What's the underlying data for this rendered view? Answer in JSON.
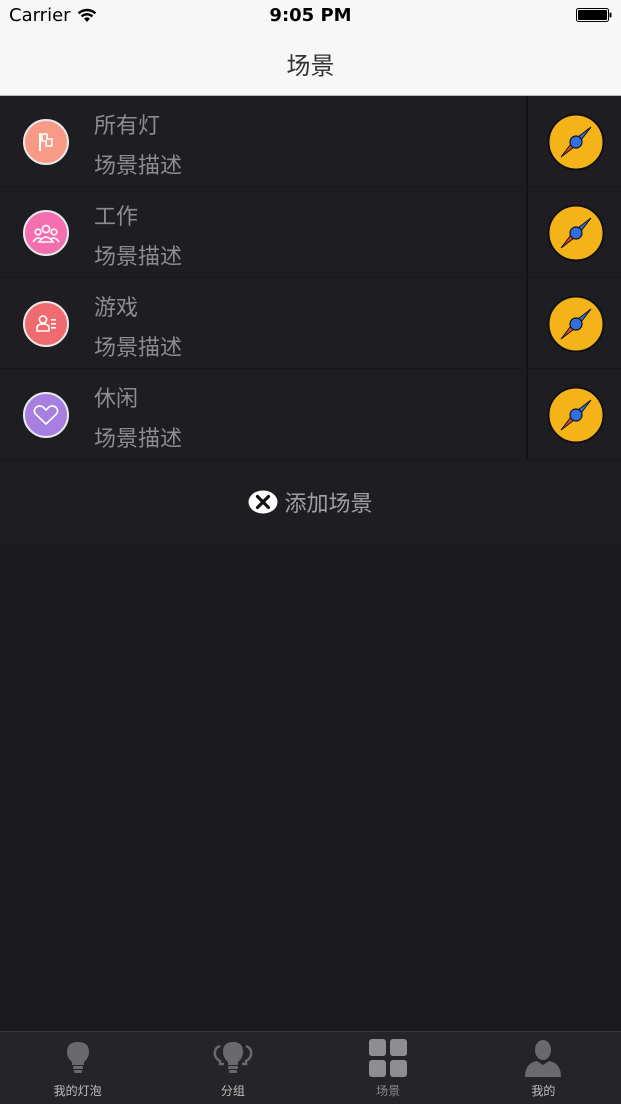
{
  "status": {
    "carrier": "Carrier",
    "time": "9:05 PM"
  },
  "nav": {
    "title": "场景"
  },
  "scenes": [
    {
      "name": "所有灯",
      "desc": "场景描述",
      "icon": "flag-icon",
      "color": "#f79b87"
    },
    {
      "name": "工作",
      "desc": "场景描述",
      "icon": "group-icon",
      "color": "#f46fb0"
    },
    {
      "name": "游戏",
      "desc": "场景描述",
      "icon": "contact-card-icon",
      "color": "#f06b6f"
    },
    {
      "name": "休闲",
      "desc": "场景描述",
      "icon": "heart-icon",
      "color": "#a77fe0"
    }
  ],
  "add_scene": {
    "label": "添加场景"
  },
  "tabs": [
    {
      "label": "我的灯泡",
      "icon": "bulb-icon",
      "active": false
    },
    {
      "label": "分组",
      "icon": "bulb-group-icon",
      "active": false
    },
    {
      "label": "场景",
      "icon": "grid-icon",
      "active": true
    },
    {
      "label": "我的",
      "icon": "person-icon",
      "active": false
    }
  ],
  "colors": {
    "background": "#1b1b1d",
    "row_background": "#1e1e22",
    "compass_yellow": "#f5b31a",
    "compass_blue": "#2f6fe0",
    "compass_red": "#e0443a",
    "text_gray": "#8d8d8f",
    "nav_background": "#f7f7f7"
  }
}
